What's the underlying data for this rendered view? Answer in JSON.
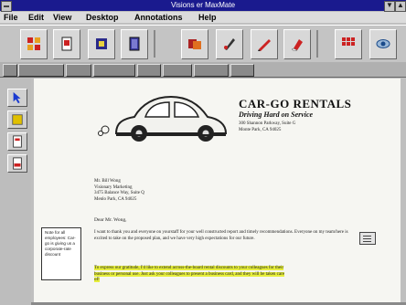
{
  "window": {
    "title": "Visions er MaxMate"
  },
  "menu": [
    {
      "label": "File"
    },
    {
      "label": "Edit"
    },
    {
      "label": "View"
    },
    {
      "label": "Desktop"
    },
    {
      "label": "Annotations"
    },
    {
      "label": "Help"
    }
  ],
  "toolbar_buttons": [
    {
      "icon": "grid-tool-icon",
      "color": "#cc2222"
    },
    {
      "icon": "document-tool-icon",
      "color": "#cc2222"
    },
    {
      "icon": "stamp-tool-icon",
      "color": "#2a2a8a"
    },
    {
      "icon": "binder-tool-icon",
      "color": "#3a3aa0"
    },
    {
      "icon": "pages-tool-icon",
      "color": "#aa2222"
    },
    {
      "icon": "pen-tool-icon",
      "color": "#333333"
    },
    {
      "icon": "pencil-tool-icon",
      "color": "#cc2222"
    },
    {
      "icon": "eraser-tool-icon",
      "color": "#cc2222"
    },
    {
      "icon": "apps-tool-icon",
      "color": "#cc2222"
    },
    {
      "icon": "eye-tool-icon",
      "color": "#1a4a8a"
    }
  ],
  "left_tools": [
    {
      "icon": "pointer-tool-icon",
      "color": "#1a3ad0"
    },
    {
      "icon": "note-tool-icon",
      "color": "#e0c000"
    },
    {
      "icon": "page-tool-icon",
      "color": "#cc2222"
    },
    {
      "icon": "highlight-tool-icon",
      "color": "#cc2222"
    }
  ],
  "letterhead": {
    "company": "CAR-GO RENTALS",
    "tagline": "Driving Hard on Service",
    "address": "300 Shannon Parkway, Suite G\nMonte Park, CA 94025"
  },
  "letter": {
    "recipient": "Mr. Bill Wong\nVisionary Marketing\n3475 Balance Way, Suite Q\nMenlo Park, CA 94025",
    "salutation": "Dear Mr. Wong,",
    "paragraph1": "I want to thank you and everyone on yourstaff for your well constructed report and timely recommendations. Everyone on my team/here is excited to take on the proposed plan, and we have very high expectations for our future.",
    "paragraph2": "To express our gratitude, I'd like to extend across-the-board rental discounts to your colleagues for their business or personal use. Just ask your colleagues to present a business card, and they will be taken care of!"
  },
  "annotation_note": "Note for all employees: Car-go is giving us a corporate-rate discount"
}
